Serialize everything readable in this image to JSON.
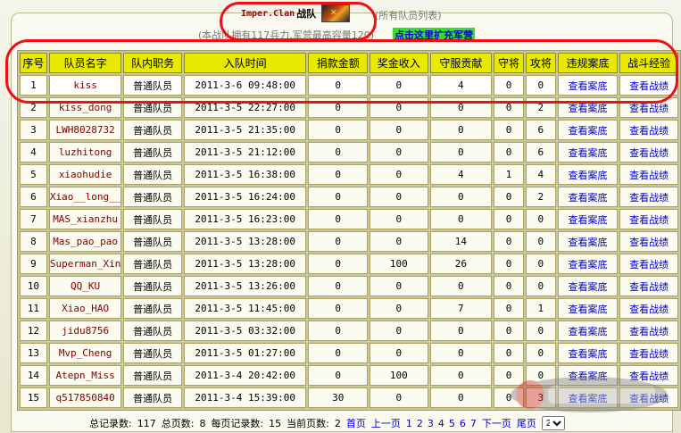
{
  "header": {
    "clan_name": "Imper.Clan",
    "team_word": "战队",
    "hint": "(所有队员列表)",
    "summary": "(本战队拥有117兵力,军营最高容量120)",
    "expand_link": "点击这里扩充军营"
  },
  "table": {
    "columns": [
      "序号",
      "队员名字",
      "队内职务",
      "入队时间",
      "捐款金额",
      "奖金收入",
      "守服贡献",
      "守将",
      "攻将",
      "违规案底",
      "战斗经验"
    ],
    "rows": [
      [
        "1",
        "kiss",
        "普通队员",
        "2011-3-6 09:48:00",
        "0",
        "0",
        "4",
        "0",
        "0",
        "查看案底",
        "查看战绩"
      ],
      [
        "2",
        "kiss_dong",
        "普通队员",
        "2011-3-5 22:27:00",
        "0",
        "0",
        "0",
        "0",
        "2",
        "查看案底",
        "查看战绩"
      ],
      [
        "3",
        "LWH8028732",
        "普通队员",
        "2011-3-5 21:35:00",
        "0",
        "0",
        "0",
        "0",
        "6",
        "查看案底",
        "查看战绩"
      ],
      [
        "4",
        "luzhitong",
        "普通队员",
        "2011-3-5 21:12:00",
        "0",
        "0",
        "0",
        "0",
        "6",
        "查看案底",
        "查看战绩"
      ],
      [
        "5",
        "xiaohudie",
        "普通队员",
        "2011-3-5 16:38:00",
        "0",
        "0",
        "4",
        "1",
        "4",
        "查看案底",
        "查看战绩"
      ],
      [
        "6",
        "Xiao__long__",
        "普通队员",
        "2011-3-5 16:24:00",
        "0",
        "0",
        "0",
        "0",
        "2",
        "查看案底",
        "查看战绩"
      ],
      [
        "7",
        "MAS_xianzhu",
        "普通队员",
        "2011-3-5 16:23:00",
        "0",
        "0",
        "0",
        "0",
        "0",
        "查看案底",
        "查看战绩"
      ],
      [
        "8",
        "Mas_pao_pao",
        "普通队员",
        "2011-3-5 13:28:00",
        "0",
        "0",
        "14",
        "0",
        "0",
        "查看案底",
        "查看战绩"
      ],
      [
        "9",
        "Superman_Xin",
        "普通队员",
        "2011-3-5 13:28:00",
        "0",
        "100",
        "26",
        "0",
        "0",
        "查看案底",
        "查看战绩"
      ],
      [
        "10",
        "QQ_KU",
        "普通队员",
        "2011-3-5 13:26:00",
        "0",
        "0",
        "0",
        "0",
        "0",
        "查看案底",
        "查看战绩"
      ],
      [
        "11",
        "Xiao_HAO",
        "普通队员",
        "2011-3-5 11:45:00",
        "0",
        "0",
        "7",
        "0",
        "1",
        "查看案底",
        "查看战绩"
      ],
      [
        "12",
        "jidu8756",
        "普通队员",
        "2011-3-5 03:32:00",
        "0",
        "0",
        "0",
        "0",
        "0",
        "查看案底",
        "查看战绩"
      ],
      [
        "13",
        "Mvp_Cheng",
        "普通队员",
        "2011-3-5 01:27:00",
        "0",
        "0",
        "0",
        "0",
        "0",
        "查看案底",
        "查看战绩"
      ],
      [
        "14",
        "Atepn_Miss",
        "普通队员",
        "2011-3-4 20:42:00",
        "0",
        "100",
        "0",
        "0",
        "0",
        "查看案底",
        "查看战绩"
      ],
      [
        "15",
        "q517850840",
        "普通队员",
        "2011-3-4 15:39:00",
        "30",
        "0",
        "0",
        "0",
        "3",
        "查看案底",
        "查看战绩"
      ]
    ]
  },
  "pager": {
    "total_records_label": "总记录数:",
    "total_records": "117",
    "total_pages_label": "总页数:",
    "total_pages": "8",
    "per_page_label": "每页记录数:",
    "per_page": "15",
    "current_page_label": "当前页数:",
    "current_page": "2",
    "first": "首页",
    "prev": "上一页",
    "pages": [
      "1",
      "2",
      "3",
      "4",
      "5",
      "6",
      "7"
    ],
    "next": "下一页",
    "last": "尾页",
    "select_value": "2"
  },
  "colors": {
    "header_bg": "#e8e800",
    "link": "#0000cc",
    "name": "#800000",
    "annotation_ring": "#ee1111",
    "expand_bg": "#33dd33"
  }
}
